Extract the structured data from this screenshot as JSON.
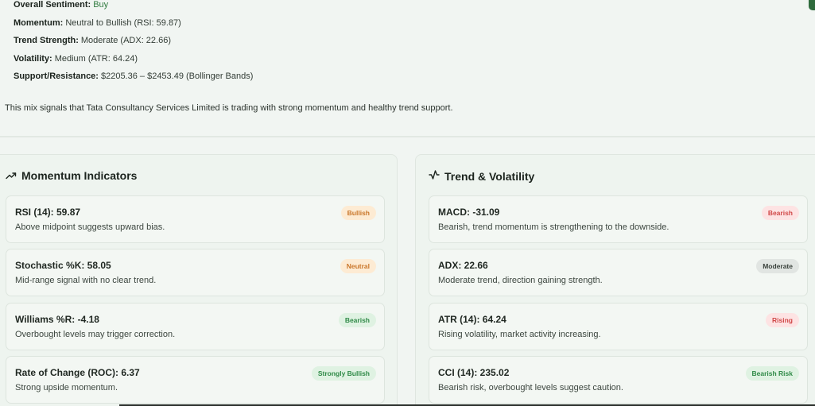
{
  "summary": {
    "rows": [
      {
        "label": "Overall Sentiment:",
        "value": "Buy"
      },
      {
        "label": "Momentum:",
        "value": "Neutral to Bullish (RSI: 59.87)"
      },
      {
        "label": "Trend Strength:",
        "value": "Moderate (ADX: 22.66)"
      },
      {
        "label": "Volatility:",
        "value": "Medium (ATR: 64.24)"
      },
      {
        "label": "Support/Resistance:",
        "value": "$2205.36 – $2453.49 (Bollinger Bands)"
      }
    ],
    "paragraph": "This mix signals that Tata Consultancy Services Limited is trading with strong momentum and healthy trend support."
  },
  "momentum": {
    "title": "Momentum Indicators",
    "icon": "trending-up-icon",
    "cards": [
      {
        "title": "RSI (14): 59.87",
        "desc": "Above midpoint suggests upward bias.",
        "badge": "Bullish"
      },
      {
        "title": "Stochastic %K: 58.05",
        "desc": "Mid-range signal with no clear trend.",
        "badge": "Neutral"
      },
      {
        "title": "Williams %R: -4.18",
        "desc": "Overbought levels may trigger correction.",
        "badge": "Bearish"
      },
      {
        "title": "Rate of Change (ROC): 6.37",
        "desc": "Strong upside momentum.",
        "badge": "Strongly Bullish"
      }
    ]
  },
  "trend": {
    "title": "Trend & Volatility",
    "icon": "activity-pulse-icon",
    "cards": [
      {
        "title": "MACD: -31.09",
        "desc": "Bearish, trend momentum is strengthening to the downside.",
        "badge": "Bearish"
      },
      {
        "title": "ADX: 22.66",
        "desc": "Moderate trend, direction gaining strength.",
        "badge": "Moderate"
      },
      {
        "title": "ATR (14): 64.24",
        "desc": "Rising volatility, market activity increasing.",
        "badge": "Rising"
      },
      {
        "title": "CCI (14): 235.02",
        "desc": "Bearish risk, overbought levels suggest caution.",
        "badge": "Bearish Risk"
      }
    ]
  },
  "colors": {
    "accent": "#2f6b3d",
    "badge_orange_bg": "#fdebd3",
    "badge_orange_fg": "#c9762a",
    "badge_green_bg": "#dff2e2",
    "badge_green_fg": "#2f8a47",
    "badge_red_bg": "#fde3e3",
    "badge_red_fg": "#d04848",
    "badge_gray_bg": "#e1e5e2",
    "badge_gray_fg": "#3a423c"
  }
}
